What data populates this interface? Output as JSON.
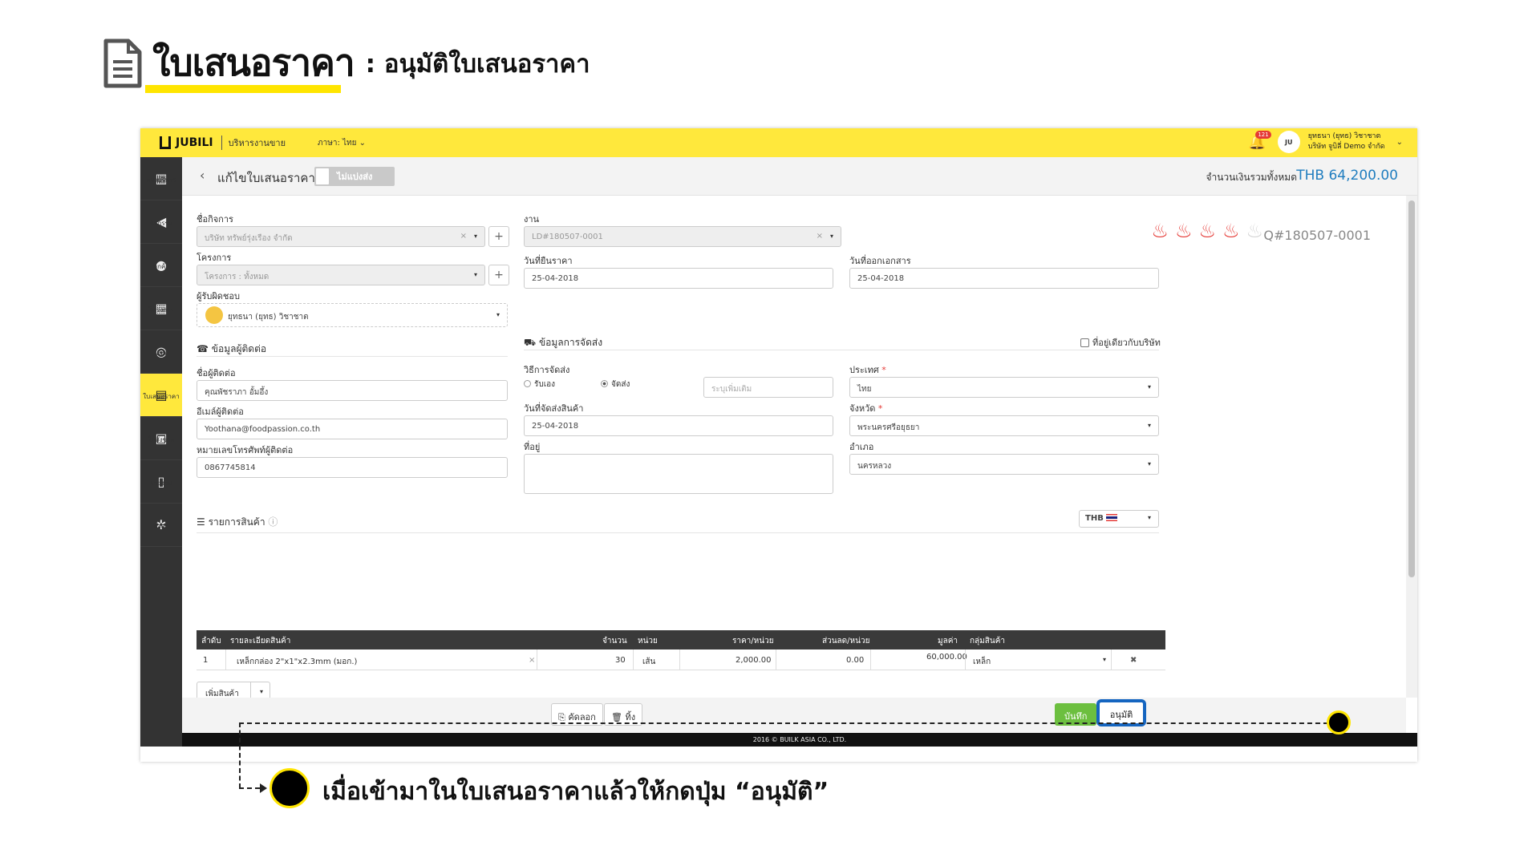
{
  "heading": {
    "title": "ใบเสนอราคา",
    "subtitle": ": อนุมัติใบเสนอราคา"
  },
  "topbar": {
    "logo": "JUBILI",
    "module": "บริหารงานขาย",
    "language": "ภาษา: ไทย",
    "notification_count": "121",
    "avatar_text": "JU",
    "user_name": "ยุทธนา (ยุทธ) วิชาชาต",
    "company": "บริษัท จูบิลี่ Demo จำกัด"
  },
  "sidebar": {
    "items": [
      {
        "label": "แผงบริหาร",
        "icon": "chart-icon",
        "glyph": "▥"
      },
      {
        "label": "กิจกรรม",
        "icon": "megaphone-icon",
        "glyph": "◀"
      },
      {
        "label": "ลูกค้า",
        "icon": "users-icon",
        "glyph": "●"
      },
      {
        "label": "โครงการ",
        "icon": "building-icon",
        "glyph": "▦"
      },
      {
        "label": "งาน",
        "icon": "handshake-icon",
        "glyph": "◎"
      },
      {
        "label": "ใบเสนอราคา",
        "icon": "quotation-icon",
        "glyph": "▤"
      },
      {
        "label": "ใบสั่งขาย",
        "icon": "clipboard-icon",
        "glyph": "▣"
      },
      {
        "label": "รายงาน",
        "icon": "report-icon",
        "glyph": "▯"
      },
      {
        "label": "ตั้งค่า",
        "icon": "cogs-icon",
        "glyph": "✲"
      }
    ]
  },
  "page_head": {
    "title": "แก้ไขใบเสนอราคา",
    "toggle_label": "ไม่แบ่งส่ง",
    "total_label": "จำนวนเงินรวมทั้งหมด",
    "total_value": "THB 64,200.00"
  },
  "form": {
    "business_label": "ชื่อกิจการ",
    "business_value": "บริษัท ทรัพย์รุ่งเรือง จำกัด",
    "project_label": "โครงการ",
    "project_value": "โครงการ : ทั้งหมด",
    "owner_label": "ผู้รับผิดชอบ",
    "owner_value": "ยุทธนา (ยุทธ) วิชาชาต",
    "job_label": "งาน",
    "job_value": "LD#180507-0001",
    "price_date_label": "วันที่ยืนราคา",
    "price_date_value": "25-04-2018",
    "doc_date_label": "วันที่ออกเอกสาร",
    "doc_date_value": "25-04-2018",
    "quote_no": "Q#180507-0001",
    "hot_level": "4 of 5"
  },
  "contact": {
    "section_title": "ข้อมูลผู้ติดต่อ",
    "name_label": "ชื่อผู้ติดต่อ",
    "name_value": "คุณพัชราภา อั้มอึ้ง",
    "email_label": "อีเมล์ผู้ติดต่อ",
    "email_value": "Yoothana@foodpassion.co.th",
    "phone_label": "หมายเลขโทรศัพท์ผู้ติดต่อ",
    "phone_value": "0867745814"
  },
  "shipping": {
    "section_title": "ข้อมูลการจัดส่ง",
    "same_address_label": "ที่อยู่เดียวกับบริษัท",
    "method_label": "วิธีการจัดส่ง",
    "method_pickup": "รับเอง",
    "method_deliver": "จัดส่ง",
    "extra_placeholder": "ระบุเพิ่มเติม",
    "ship_date_label": "วันที่จัดส่งสินค้า",
    "ship_date_value": "25-04-2018",
    "address_label": "ที่อยู่",
    "country_label": "ประเทศ",
    "country_value": "ไทย",
    "province_label": "จังหวัด",
    "province_value": "พระนครศรีอยุธยา",
    "district_label": "อำเภอ",
    "district_value": "นครหลวง"
  },
  "products": {
    "section_title": "รายการสินค้า",
    "currency": "THB",
    "columns": [
      "ลำดับ",
      "รายละเอียดสินค้า",
      "จำนวน",
      "หน่วย",
      "ราคา/หน่วย",
      "ส่วนลด/หน่วย",
      "มูลค่า",
      "กลุ่มสินค้า"
    ],
    "rows": [
      {
        "no": "1",
        "desc": "เหล็กกล่อง 2\"x1\"x2.3mm (มอก.)",
        "qty": "30",
        "unit": "เส้น",
        "price": "2,000.00",
        "discount": "0.00",
        "amount": "60,000.00",
        "group": "เหล็ก"
      }
    ],
    "add_button": "เพิ่มสินค้า"
  },
  "actions": {
    "copy": "คัดลอก",
    "delete": "ทิ้ง",
    "save": "บันทึก",
    "approve": "อนุมัติ"
  },
  "footer": "2016 © BUILK ASIA CO., LTD.",
  "annotation": "เมื่อเข้ามาในใบเสนอราคาแล้วให้กดปุ่ม “อนุมัติ”",
  "colors": {
    "accent": "#ffe83c",
    "sidebar": "#333333",
    "approve_border": "#1565c0",
    "total": "#1f7dbf",
    "hot": "#e53935"
  }
}
